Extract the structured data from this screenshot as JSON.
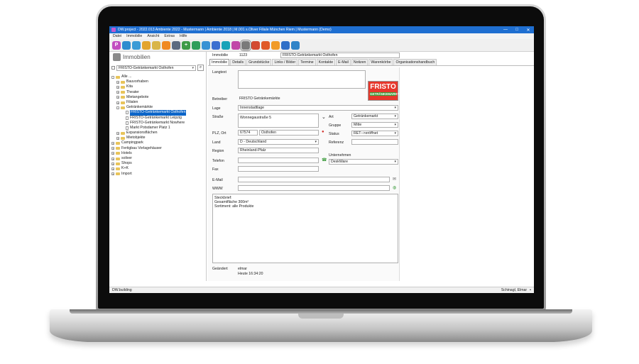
{
  "window": {
    "title": "DW.project - 2022.013 Ambiente 2022 - Mustermann | Ambiente 2018 | M.001 s.Oliver Filiale München Riem | Mustermann (Demo)",
    "minimize": "—",
    "maximize": "□",
    "close": "✕"
  },
  "menu": [
    "Datei",
    "Immobilie",
    "Ansicht",
    "Extras",
    "Hilfe"
  ],
  "toolbar": [
    {
      "icon": "p-icon",
      "glyph": "P",
      "color": "#c24dc0"
    },
    {
      "icon": "contacts-icon",
      "glyph": "",
      "color": "#2e8ccf"
    },
    {
      "icon": "mail-icon",
      "glyph": "",
      "color": "#3c9bd6"
    },
    {
      "icon": "calendar-icon",
      "glyph": "",
      "color": "#e3a52e"
    },
    {
      "icon": "folder-icon",
      "glyph": "",
      "color": "#d9b548"
    },
    {
      "icon": "cart-icon",
      "glyph": "",
      "color": "#f08a24"
    },
    {
      "icon": "print-icon",
      "glyph": "",
      "color": "#5d6b80"
    },
    {
      "icon": "plus-icon",
      "glyph": "+",
      "color": "#3d9a47"
    },
    {
      "icon": "arrow-icon",
      "glyph": "",
      "color": "#2e9e5b"
    },
    {
      "icon": "export-icon",
      "glyph": "",
      "color": "#3892d4"
    },
    {
      "icon": "car-icon",
      "glyph": "",
      "color": "#3c6fd0"
    },
    {
      "icon": "home-icon",
      "glyph": "",
      "color": "#19a3b8"
    },
    {
      "icon": "pie-icon",
      "glyph": "",
      "color": "#c146a8"
    },
    {
      "icon": "building-icon",
      "glyph": "",
      "color": "#7a7a7a"
    },
    {
      "icon": "person-icon",
      "glyph": "",
      "color": "#d34a32"
    },
    {
      "icon": "network-icon",
      "glyph": "",
      "color": "#e05a28"
    },
    {
      "icon": "box-icon",
      "glyph": "",
      "color": "#f19b27"
    },
    {
      "icon": "grid-icon",
      "glyph": "",
      "color": "#2f6fc8"
    },
    {
      "icon": "id-icon",
      "glyph": "",
      "color": "#2f84c8"
    }
  ],
  "left": {
    "module_title": "Immobilien",
    "search_value": "FRISTO-Getränkemarkt Osthofen",
    "tree": [
      {
        "level": 0,
        "type": "folder",
        "exp": "-",
        "label": "Alle ..."
      },
      {
        "level": 1,
        "type": "folder",
        "exp": "+",
        "label": "Bauvorhaben"
      },
      {
        "level": 1,
        "type": "folder",
        "exp": "+",
        "label": "Kita"
      },
      {
        "level": 1,
        "type": "folder",
        "exp": "+",
        "label": "Theater"
      },
      {
        "level": 1,
        "type": "folder",
        "exp": "+",
        "label": "Mietangebote"
      },
      {
        "level": 1,
        "type": "folder",
        "exp": "+",
        "label": "Filialen"
      },
      {
        "level": 1,
        "type": "folder",
        "exp": "-",
        "label": "Getränkemärkte"
      },
      {
        "level": 2,
        "type": "doc",
        "exp": "",
        "label": "FRISTO-Getränkemarkt Osthofen",
        "selected": true
      },
      {
        "level": 2,
        "type": "doc",
        "exp": "",
        "label": "FRISTO-Getränkemarkt Leipzig"
      },
      {
        "level": 2,
        "type": "doc",
        "exp": "",
        "label": "FRISTO-Getränkemarkt Nowhere"
      },
      {
        "level": 2,
        "type": "doc",
        "exp": "",
        "label": "Markt Potsdamer Platz 1"
      },
      {
        "level": 1,
        "type": "folder",
        "exp": "+",
        "label": "Expansionsflächen"
      },
      {
        "level": 1,
        "type": "folder",
        "exp": "+",
        "label": "Mietobjekte"
      },
      {
        "level": 0,
        "type": "folder",
        "exp": "+",
        "label": "Campingpark"
      },
      {
        "level": 0,
        "type": "folder",
        "exp": "+",
        "label": "Fertigbau Vorlagehäuser"
      },
      {
        "level": 0,
        "type": "folder",
        "exp": "+",
        "label": "Hotels"
      },
      {
        "level": 0,
        "type": "folder",
        "exp": "+",
        "label": "soliver"
      },
      {
        "level": 0,
        "type": "folder",
        "exp": "+",
        "label": "Shops"
      },
      {
        "level": 0,
        "type": "folder",
        "exp": "+",
        "label": "K+K"
      },
      {
        "level": 0,
        "type": "folder",
        "exp": "+",
        "label": "Import"
      }
    ]
  },
  "right": {
    "immobilie_label": "Immobilie",
    "immobilie_number": "1123",
    "immobilie_name": "FRISTO-Getränkemarkt Osthofen",
    "tabs": [
      "Immobilie",
      "Details",
      "Grundstücke",
      "Links / Bilder",
      "Termine",
      "Kontakte",
      "E-Mail",
      "Notizen",
      "Warenkörbe",
      "Organisationshandbuch"
    ],
    "form": {
      "langtext_label": "Langtext",
      "betreiber_label": "Betreiber",
      "betreiber_value": "FRISTO Getränkemärkte",
      "lage_label": "Lage",
      "lage_value": "Innenstadtlage",
      "strasse_label": "Straße",
      "strasse_value": "Wonnegaustraße 5",
      "plz_label": "PLZ, Ort",
      "plz_value": "67574",
      "ort_value": "Osthofen",
      "land_label": "Land",
      "land_value": "D - Deutschland",
      "region_label": "Region",
      "region_value": "Rheinland-Pfalz",
      "telefon_label": "Telefon",
      "fax_label": "Fax",
      "email_label": "E-Mail",
      "www_label": "WWW",
      "art_label": "Art",
      "art_value": "Getränkemarkt",
      "gruppe_label": "Gruppe",
      "gruppe_value": "Mitte",
      "status_label": "Status",
      "status_value": "RET-->eröffnet",
      "referenz_label": "Referenz",
      "unternehmen_label": "Unternehmen",
      "unternehmen_value": "DeskWare",
      "notes": [
        "Steckbrief:",
        "Gesamtfläche 300m²",
        "Sortiment: alle Produkte"
      ],
      "geaendert_label": "Geändert",
      "geaendert_user": "elmar",
      "geaendert_date": "Heute 16:34:20"
    },
    "logo": {
      "text": "FRISTO",
      "sub": "GETRÄNKEMARKT"
    }
  },
  "status": {
    "left": "DW.building",
    "right": "Schinagl, Elmar"
  }
}
